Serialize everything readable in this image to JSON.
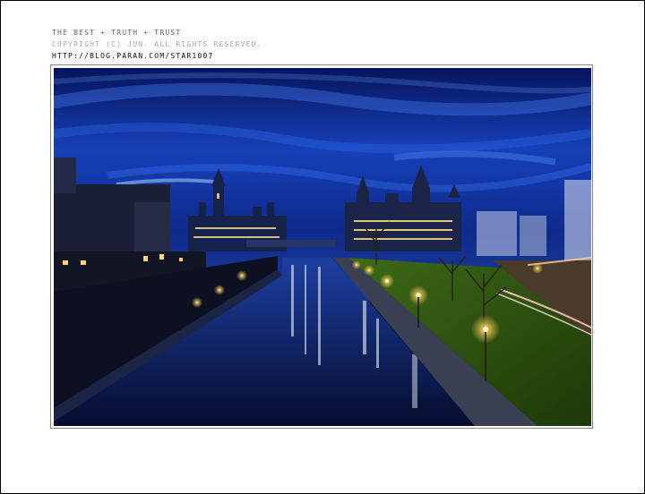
{
  "credits": {
    "line1": "THE BEST + TRUTH + TRUST",
    "line2": "COPYRIGHT (C) JUN. ALL RIGHTS RESERVED.",
    "line3": "HTTP://BLOG.PARAN.COM/STAR1007"
  },
  "photo": {
    "scene": "night-canal-cityscape",
    "colors": {
      "sky_top": "#0b1a6b",
      "sky_mid": "#1d4fd1",
      "water": "#0a1f63",
      "lamp_glow": "#ffd878",
      "grass": "#2f5a12"
    }
  }
}
